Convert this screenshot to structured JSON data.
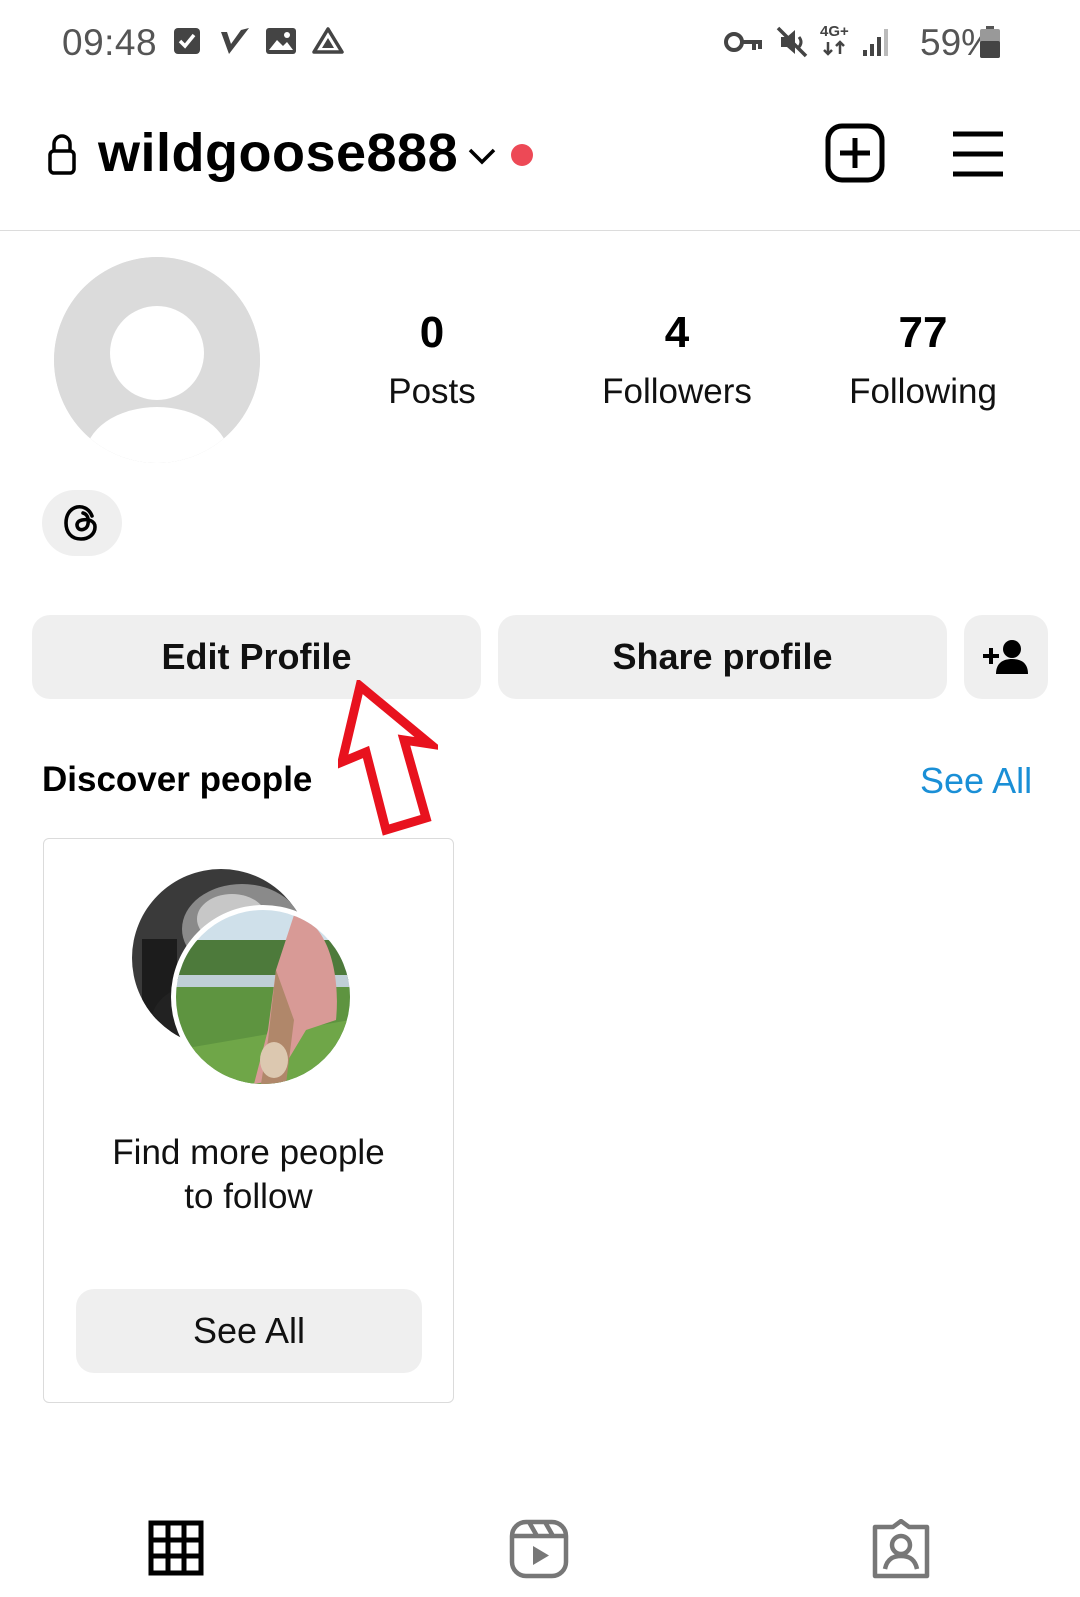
{
  "status_bar": {
    "time": "09:48",
    "battery_percent": "59%",
    "network_label": "4G+",
    "left_icons": [
      "checkbox-icon",
      "v-app-icon",
      "image-icon",
      "drive-icon"
    ],
    "right_icons": [
      "vpn-key-icon",
      "mute-icon",
      "network-4g-icon",
      "signal-icon",
      "battery-icon"
    ]
  },
  "header": {
    "username": "wildgoose888",
    "has_notification_dot": true,
    "notification_color": "#ed4956"
  },
  "profile": {
    "stats": [
      {
        "value": "0",
        "label": "Posts"
      },
      {
        "value": "4",
        "label": "Followers"
      },
      {
        "value": "77",
        "label": "Following"
      }
    ]
  },
  "actions": {
    "edit_profile": "Edit Profile",
    "share_profile": "Share profile"
  },
  "discover": {
    "title": "Discover people",
    "see_all": "See All",
    "card_text_line1": "Find more people",
    "card_text_line2": "to follow",
    "card_button": "See All"
  },
  "annotation": {
    "arrow_color": "#e8121e"
  },
  "colors": {
    "accent_link": "#1a8fd6",
    "button_bg": "#efefef"
  }
}
